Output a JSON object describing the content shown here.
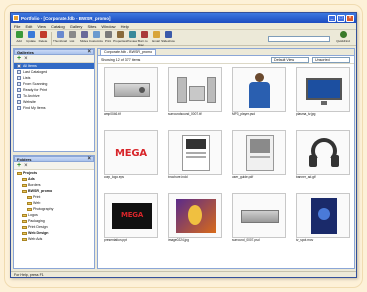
{
  "window": {
    "title": "Portfolio - [Corporate.fdb - BWSR_promo]"
  },
  "menu": [
    "File",
    "Edit",
    "View",
    "Catalog",
    "Gallery",
    "Sites",
    "Window",
    "Help"
  ],
  "toolbar": {
    "left": [
      {
        "label": "Add",
        "icon": "add-icon",
        "color": "#3a9a3a"
      },
      {
        "label": "Update",
        "icon": "update-icon",
        "color": "#3a7ad8"
      },
      {
        "label": "Delete",
        "icon": "delete-icon",
        "color": "#c23a2a"
      }
    ],
    "middle": [
      {
        "label": "Thumbnail",
        "icon": "thumbnail-view-icon",
        "color": "#6a8acf"
      },
      {
        "label": "List",
        "icon": "list-view-icon",
        "color": "#8a8a8a"
      },
      {
        "label": "Slides",
        "icon": "slides-icon",
        "color": "#6a6a9a"
      },
      {
        "label": "Customize",
        "icon": "customize-icon",
        "color": "#6a9acf"
      },
      {
        "label": "Print",
        "icon": "print-icon",
        "color": "#7a7a7a"
      },
      {
        "label": "Properties",
        "icon": "properties-icon",
        "color": "#8a6a3a"
      },
      {
        "label": "Preview",
        "icon": "preview-icon",
        "color": "#3a8a9a"
      },
      {
        "label": "Burn to Disc",
        "icon": "burn-disc-icon",
        "color": "#aa3a3a"
      },
      {
        "label": "Email",
        "icon": "email-icon",
        "color": "#d8a53a"
      },
      {
        "label": "Slideshow",
        "icon": "slideshow-icon",
        "color": "#3a5aaa"
      }
    ],
    "quickfind": "QuickFind"
  },
  "galleries": {
    "title": "Galleries",
    "items": [
      {
        "label": "All Items",
        "selected": true
      },
      {
        "label": "Last Cataloged",
        "selected": false
      },
      {
        "label": "Lists",
        "selected": false
      },
      {
        "label": "From Scanning",
        "selected": false
      },
      {
        "label": "Ready for Print",
        "selected": false
      },
      {
        "label": "To Archive",
        "selected": false
      },
      {
        "label": "Website",
        "selected": false
      },
      {
        "label": "Find My Items",
        "selected": false
      }
    ]
  },
  "folders": {
    "title": "Folders",
    "items": [
      {
        "label": "Projects",
        "level": 1,
        "bold": true
      },
      {
        "label": "Ads",
        "level": 2,
        "bold": true
      },
      {
        "label": "Borders",
        "level": 2,
        "bold": false
      },
      {
        "label": "BWSR_promo",
        "level": 2,
        "bold": true
      },
      {
        "label": "Print",
        "level": 3,
        "bold": false
      },
      {
        "label": "Web",
        "level": 3,
        "bold": false
      },
      {
        "label": "Photography",
        "level": 3,
        "bold": false
      },
      {
        "label": "Logos",
        "level": 2,
        "bold": false
      },
      {
        "label": "Packaging",
        "level": 2,
        "bold": false
      },
      {
        "label": "Print Design",
        "level": 2,
        "bold": false
      },
      {
        "label": "Web Design",
        "level": 2,
        "bold": true
      },
      {
        "label": "Web Ads",
        "level": 2,
        "bold": false
      }
    ]
  },
  "main": {
    "tab": "Corporate.fdb - BWSR_promo",
    "showing": "Showing 12 of 377 items",
    "view": "Default View",
    "sort": "Unsorted",
    "items": [
      {
        "caption": "amp0046.tif",
        "kind": "amp"
      },
      {
        "caption": "surroundsound_0007.tif",
        "kind": "speakers"
      },
      {
        "caption": "MP3_player.psd",
        "kind": "person"
      },
      {
        "caption": "plasma_tv.jpg",
        "kind": "tv"
      },
      {
        "caption": "corp_logo.eps",
        "kind": "mega"
      },
      {
        "caption": "brochure.indd",
        "kind": "brochure"
      },
      {
        "caption": "user_guide.pdf",
        "kind": "guide"
      },
      {
        "caption": "banner_ad.gif",
        "kind": "headphones"
      },
      {
        "caption": "presentation.ppt",
        "kind": "presentation"
      },
      {
        "caption": "image0224.jpg",
        "kind": "image"
      },
      {
        "caption": "surround_0007.psd",
        "kind": "receiver"
      },
      {
        "caption": "tv_spot.mov",
        "kind": "tvspot"
      }
    ]
  },
  "status": "For Help, press F1",
  "colors": {
    "titlebar": "#1b4cc0",
    "selection": "#316ac5",
    "megaRed": "#d8252a"
  }
}
